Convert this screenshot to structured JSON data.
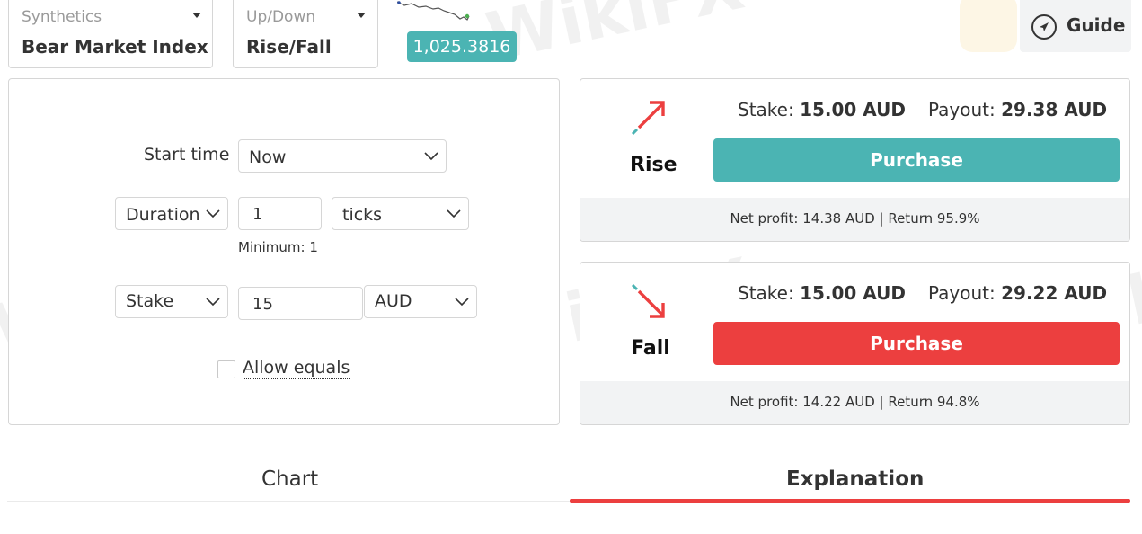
{
  "market": {
    "category_label": "Synthetics",
    "name": "Bear Market Index"
  },
  "trade_type": {
    "category_label": "Up/Down",
    "name": "Rise/Fall"
  },
  "spot_price": "1,025.3816",
  "guide": {
    "label": "Guide"
  },
  "form": {
    "start_time_label": "Start time",
    "start_time_value": "Now",
    "duration_type": "Duration",
    "duration_value": "1",
    "duration_unit": "ticks",
    "duration_minimum": "Minimum: 1",
    "amount_type": "Stake",
    "amount_value": "15",
    "currency": "AUD",
    "allow_equals_label": "Allow equals",
    "allow_equals_checked": false
  },
  "contracts": [
    {
      "type": "Rise",
      "stake_label": "Stake:",
      "stake_value": "15.00 AUD",
      "payout_label": "Payout:",
      "payout_value": "29.38 AUD",
      "button_label": "Purchase",
      "button_color": "#4bb4b3",
      "net_profit_text": "Net profit: 14.38 AUD | Return 95.9%"
    },
    {
      "type": "Fall",
      "stake_label": "Stake:",
      "stake_value": "15.00 AUD",
      "payout_label": "Payout:",
      "payout_value": "29.22 AUD",
      "button_label": "Purchase",
      "button_color": "#ec3f3f",
      "net_profit_text": "Net profit: 14.22 AUD | Return 94.8%"
    }
  ],
  "tabs": [
    {
      "label": "Chart",
      "active": false
    },
    {
      "label": "Explanation",
      "active": true
    }
  ],
  "colors": {
    "accent_green": "#4bb4b3",
    "accent_red": "#ec3f3f",
    "rise_arrow": "#ec3f3f",
    "fall_arrow": "#ec3f3f"
  },
  "icons": {
    "guide": "compass-icon",
    "dropdown": "chevron-down-icon",
    "rise": "rise-arrow-icon",
    "fall": "fall-arrow-icon",
    "sparkline": "sparkline-icon"
  },
  "watermark_text": "WikiFX"
}
